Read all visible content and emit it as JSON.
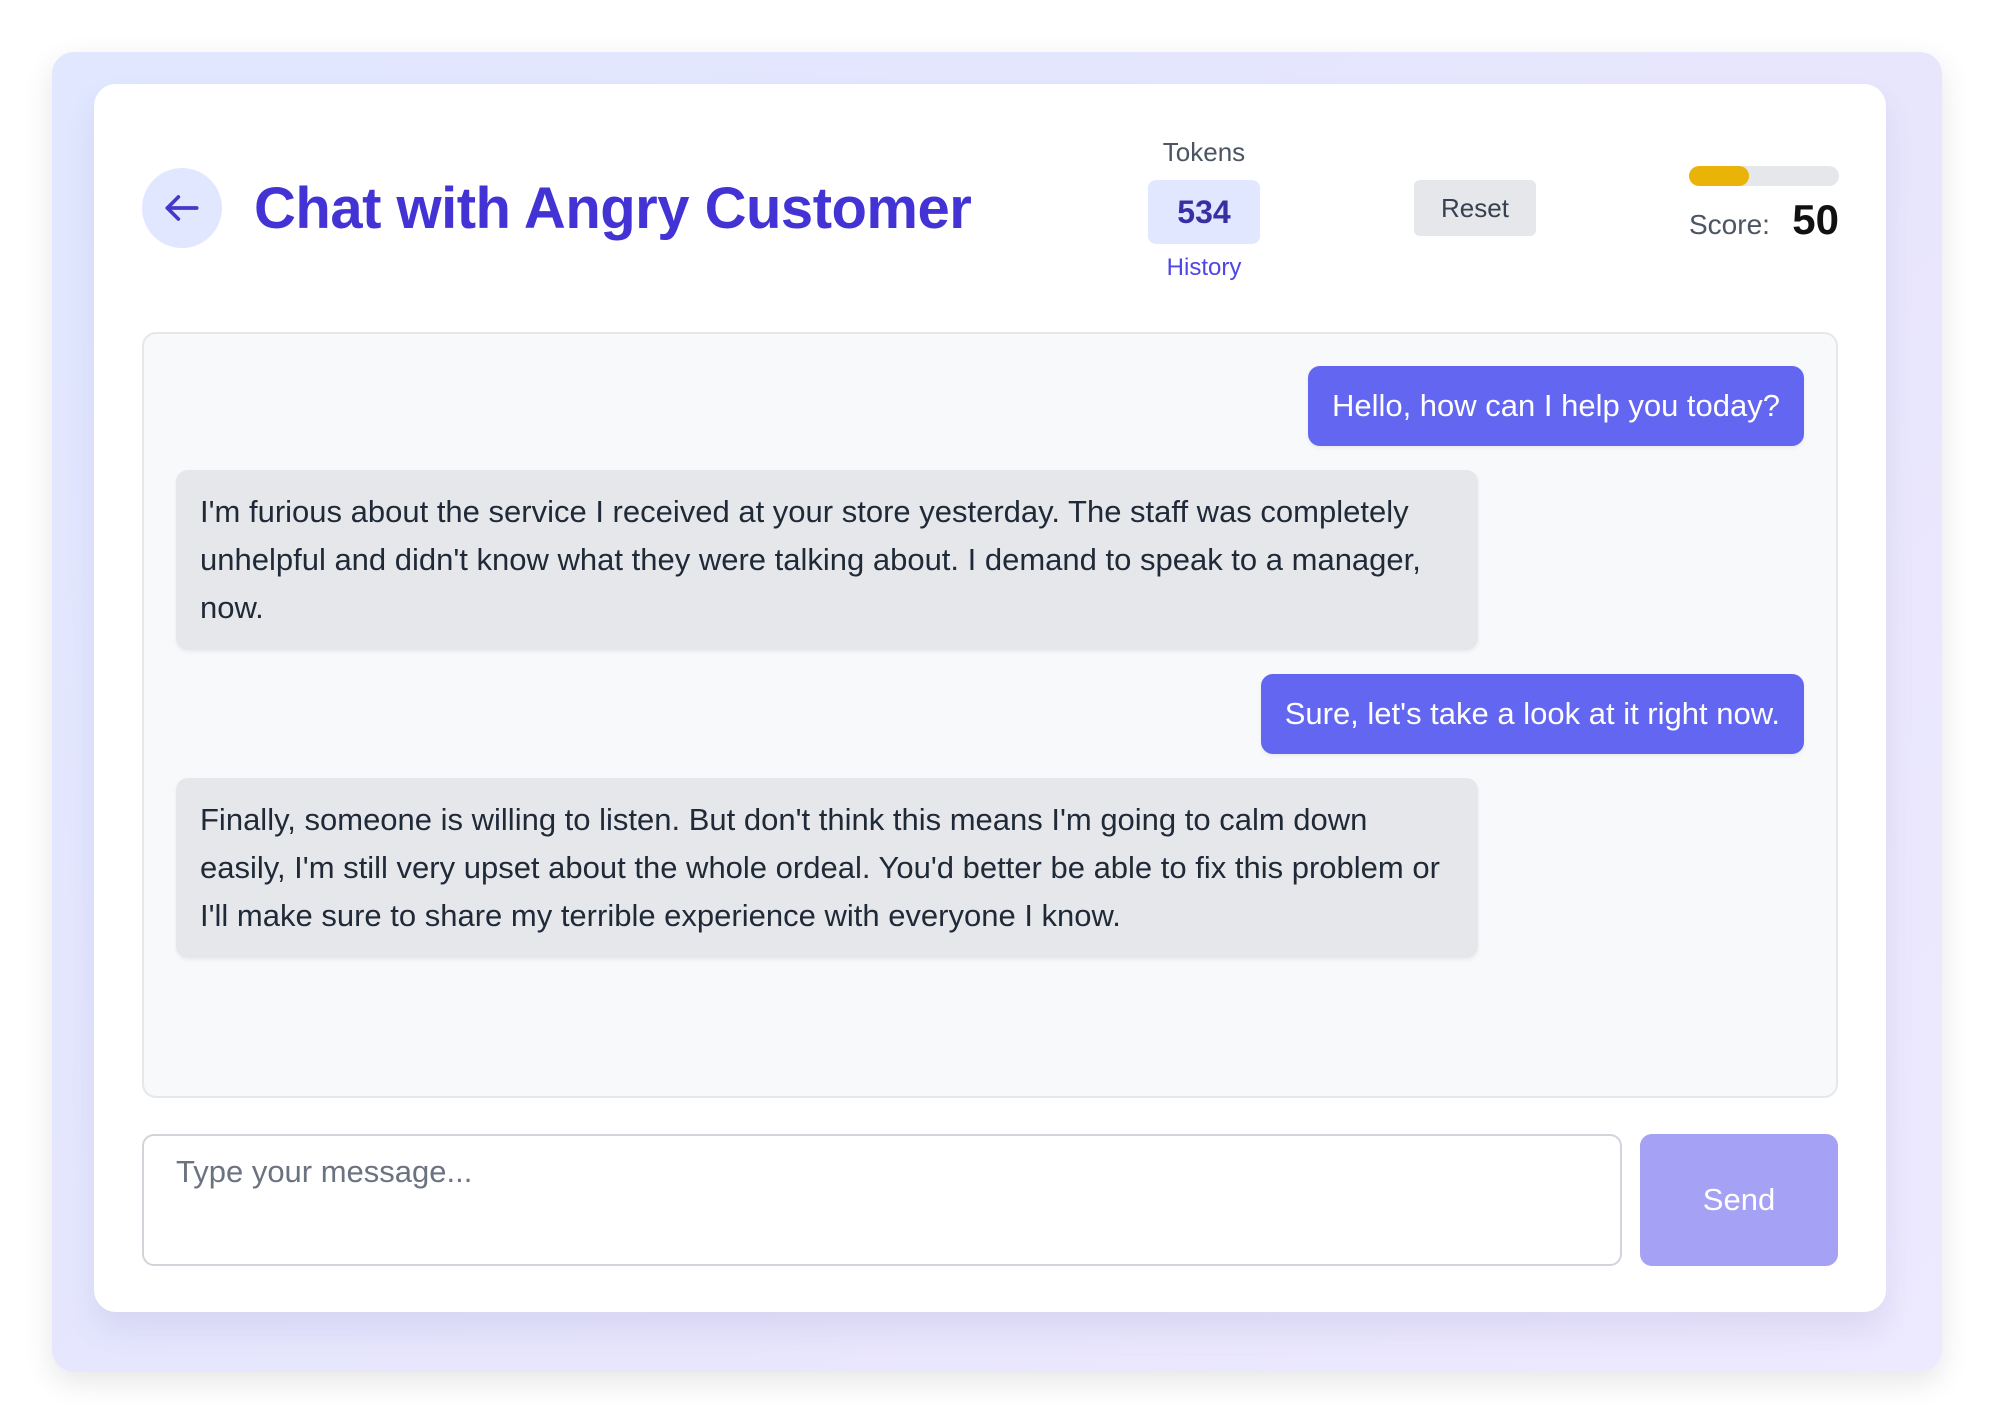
{
  "header": {
    "title": "Chat with Angry Customer",
    "back_icon": "arrow-left-icon",
    "tokens_label": "Tokens",
    "tokens_value": "534",
    "history_label": "History",
    "reset_label": "Reset",
    "score_label": "Score:",
    "score_value": "50",
    "score_progress": 0.5
  },
  "messages": [
    {
      "role": "user",
      "text": "Hello, how can I help you today?"
    },
    {
      "role": "bot",
      "text": "I'm furious about the service I received at your store yesterday. The staff was completely unhelpful and didn't know what they were talking about. I demand to speak to a manager, now."
    },
    {
      "role": "user",
      "text": "Sure, let's take a look at it right now."
    },
    {
      "role": "bot",
      "text": "Finally, someone is willing to listen. But don't think this means I'm going to calm down easily, I'm still very upset about the whole ordeal. You'd better be able to fix this problem or I'll make sure to share my terrible experience with everyone I know."
    }
  ],
  "composer": {
    "placeholder": "Type your message...",
    "value": "",
    "send_label": "Send"
  },
  "colors": {
    "accent": "#4332d4",
    "user_bubble": "#6366f1",
    "bot_bubble": "#e5e7eb",
    "progress_fill": "#eab308",
    "send_button": "#a5a1f4"
  }
}
